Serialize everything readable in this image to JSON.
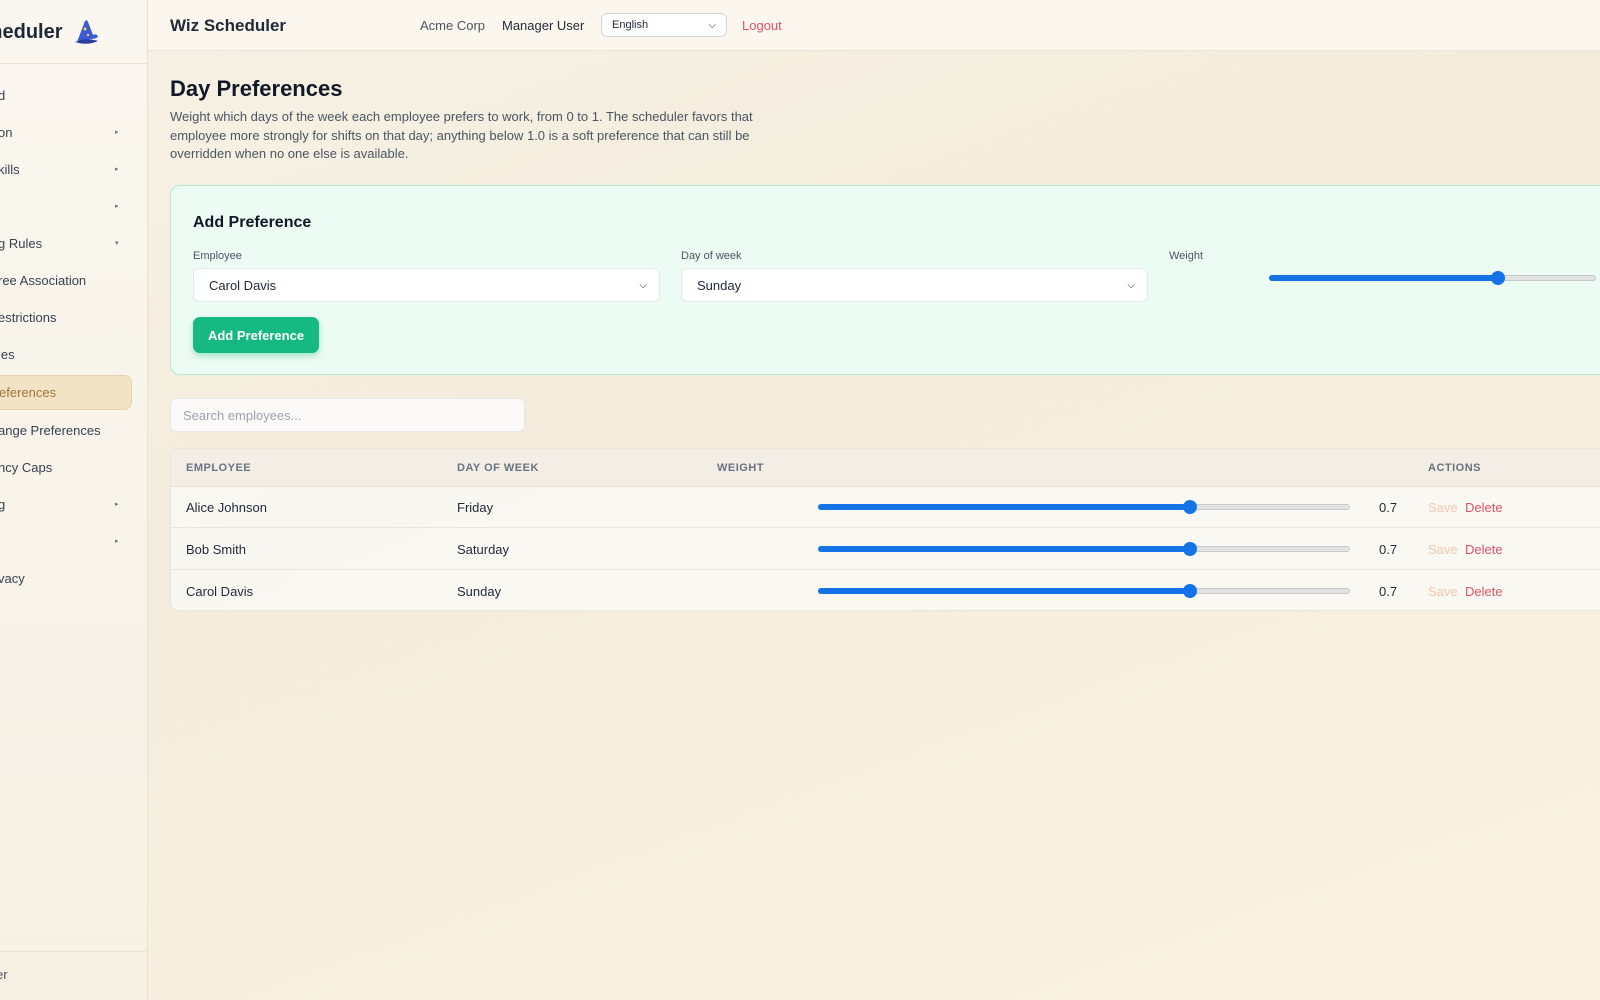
{
  "sidebar": {
    "brand": "Wiz Scheduler",
    "items": [
      {
        "label": "Dashboard",
        "visible": "d",
        "caret": ""
      },
      {
        "label": "Organization",
        "visible": "on",
        "caret": "▸"
      },
      {
        "label": "Skills",
        "visible": "kills",
        "caret": "▸"
      },
      {
        "label": "",
        "visible": "",
        "caret": "▸"
      },
      {
        "label": "Scheduling Rules",
        "visible": "g Rules",
        "caret": "▾"
      },
      {
        "label": "Employee Association",
        "visible": "ree Association",
        "caret": ""
      },
      {
        "label": "Restrictions",
        "visible": "estrictions",
        "caret": ""
      },
      {
        "label": "Roles",
        "visible": "les",
        "caret": ""
      },
      {
        "label": "Day Preferences",
        "visible": "eferences",
        "caret": ""
      },
      {
        "label": "Range Preferences",
        "visible": "ange Preferences",
        "caret": ""
      },
      {
        "label": "Frequency Caps",
        "visible": "ncy Caps",
        "caret": ""
      },
      {
        "label": "Reporting",
        "visible": "g",
        "caret": "▸"
      },
      {
        "label": "",
        "visible": "",
        "caret": "▸"
      },
      {
        "label": "Privacy",
        "visible": "vacy",
        "caret": ""
      }
    ],
    "footer": "er"
  },
  "topbar": {
    "title": "Wiz Scheduler",
    "org": "Acme Corp",
    "user": "Manager User",
    "language": "English",
    "logout": "Logout"
  },
  "page": {
    "title": "Day Preferences",
    "description": "Weight which days of the week each employee prefers to work, from 0 to 1. The scheduler favors that employee more strongly for shifts on that day; anything below 1.0 is a soft preference that can still be overridden when no one else is available."
  },
  "add_form": {
    "title": "Add Preference",
    "employee_label": "Employee",
    "employee_value": "Carol Davis",
    "day_label": "Day of week",
    "day_value": "Sunday",
    "weight_label": "Weight",
    "weight_value": 0.7,
    "button": "Add Preference"
  },
  "search": {
    "placeholder": "Search employees..."
  },
  "table": {
    "headers": {
      "employee": "EMPLOYEE",
      "day": "DAY OF WEEK",
      "weight": "WEIGHT",
      "actions": "ACTIONS"
    },
    "save_label": "Save",
    "delete_label": "Delete",
    "rows": [
      {
        "employee": "Alice Johnson",
        "day": "Friday",
        "weight": 0.7,
        "weight_text": "0.7"
      },
      {
        "employee": "Bob Smith",
        "day": "Saturday",
        "weight": 0.7,
        "weight_text": "0.7"
      },
      {
        "employee": "Carol Davis",
        "day": "Sunday",
        "weight": 0.7,
        "weight_text": "0.7"
      }
    ]
  },
  "colors": {
    "accent": "#16b981",
    "slider": "#1473e6",
    "danger": "#e0536a",
    "active_nav": "#a0753a"
  }
}
